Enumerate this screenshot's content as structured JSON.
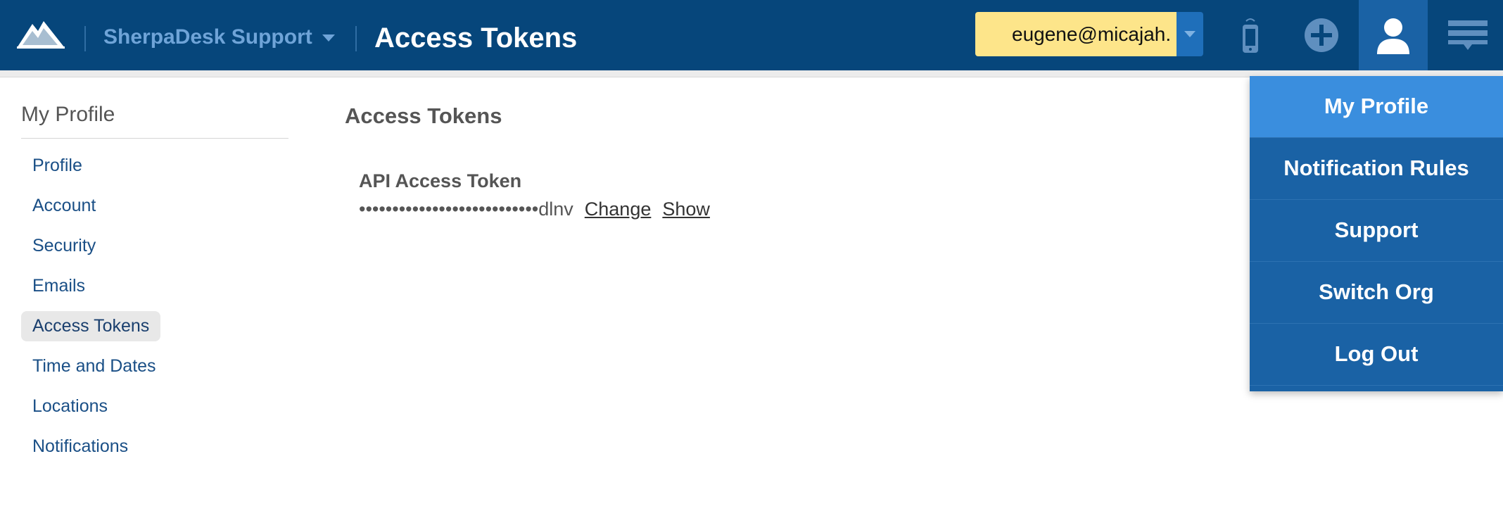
{
  "header": {
    "org_name": "SherpaDesk Support",
    "page_title": "Access Tokens",
    "user_email": "eugene@micajah.",
    "colors": {
      "bar": "#06467b",
      "accent": "#1a62a5",
      "user_box": "#fde58a"
    },
    "icons": [
      "logo-mountain-icon",
      "chevron-down-icon",
      "mobile-phone-icon",
      "plus-circle-icon",
      "user-icon",
      "hamburger-menu-icon"
    ]
  },
  "sidebar": {
    "title": "My Profile",
    "items": [
      {
        "label": "Profile"
      },
      {
        "label": "Account"
      },
      {
        "label": "Security"
      },
      {
        "label": "Emails"
      },
      {
        "label": "Access Tokens",
        "active": true
      },
      {
        "label": "Time and Dates"
      },
      {
        "label": "Locations"
      },
      {
        "label": "Notifications"
      }
    ]
  },
  "main": {
    "title": "Access Tokens",
    "token": {
      "label": "API Access Token",
      "masked_value": "•••••••••••••••••••••••••••dlnv",
      "change_label": "Change",
      "show_label": "Show"
    }
  },
  "user_menu": {
    "items": [
      {
        "label": "My Profile",
        "selected": true
      },
      {
        "label": "Notification Rules"
      },
      {
        "label": "Support"
      },
      {
        "label": "Switch Org"
      },
      {
        "label": "Log Out"
      }
    ]
  }
}
